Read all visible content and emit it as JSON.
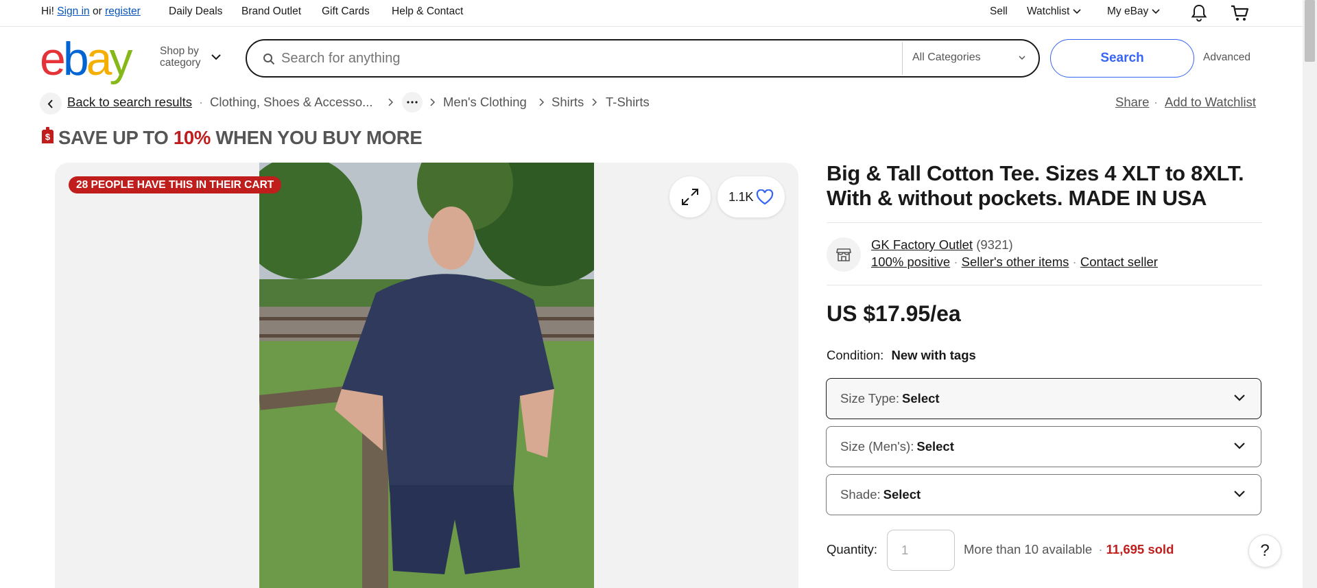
{
  "topbar": {
    "greeting": "Hi!",
    "sign_in": "Sign in",
    "or": "or",
    "register": "register",
    "daily_deals": "Daily Deals",
    "brand_outlet": "Brand Outlet",
    "gift_cards": "Gift Cards",
    "help_contact": "Help & Contact",
    "sell": "Sell",
    "watchlist": "Watchlist",
    "my_ebay": "My eBay"
  },
  "header": {
    "logo_letters": [
      "e",
      "b",
      "a",
      "y"
    ],
    "logo_colors": [
      "#e53238",
      "#0064d2",
      "#f5af02",
      "#86b817"
    ],
    "shop_by_line1": "Shop by",
    "shop_by_line2": "category",
    "search_placeholder": "Search for anything",
    "category_select": "All Categories",
    "search_button": "Search",
    "advanced": "Advanced"
  },
  "breadcrumb": {
    "back": "Back to search results",
    "items": [
      "Clothing, Shoes & Accesso...",
      "Men's Clothing",
      "Shirts",
      "T-Shirts"
    ],
    "share": "Share",
    "add_watchlist": "Add to Watchlist"
  },
  "promo": {
    "prefix": "SAVE UP TO ",
    "percent": "10%",
    "suffix": " WHEN YOU BUY MORE"
  },
  "gallery": {
    "cart_badge": "28 PEOPLE HAVE THIS IN THEIR CART",
    "watch_count": "1.1K"
  },
  "item": {
    "title": "Big & Tall Cotton Tee. Sizes 4 XLT to 8XLT. With & without pockets. MADE IN USA",
    "seller_name": "GK Factory Outlet",
    "seller_score": "(9321)",
    "positive": "100% positive",
    "other_items": "Seller's other items",
    "contact": "Contact seller",
    "price": "US $17.95/ea",
    "condition_label": "Condition:",
    "condition_value": "New with tags",
    "size_type_label": "Size Type:",
    "size_type_value": "Select",
    "size_label": "Size (Men's):",
    "size_value": "Select",
    "shade_label": "Shade:",
    "shade_value": "Select",
    "quantity_label": "Quantity:",
    "quantity_value": "1",
    "available": "More than 10 available",
    "sold": "11,695 sold",
    "help": "?"
  },
  "colors": {
    "accent_blue": "#3665f3",
    "sale_red": "#c01d1d",
    "link_blue": "#0654ba"
  }
}
